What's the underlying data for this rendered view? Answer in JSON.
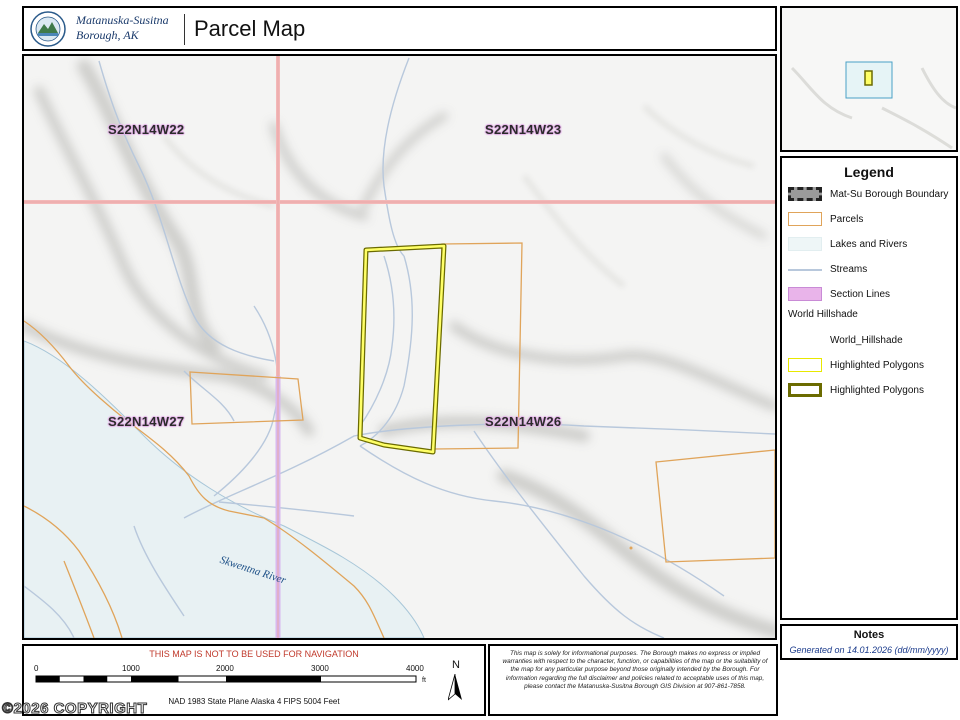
{
  "header": {
    "org_line1": "Matanuska-Susitna",
    "org_line2": "Borough, AK",
    "title": "Parcel Map"
  },
  "map": {
    "section_labels": [
      "S22N14W22",
      "S22N14W23",
      "S22N14W27",
      "S22N14W26"
    ],
    "river_label": "Skwentna River"
  },
  "legend": {
    "title": "Legend",
    "items": [
      {
        "label": "Mat-Su Borough Boundary"
      },
      {
        "label": "Parcels"
      },
      {
        "label": "Lakes and Rivers"
      },
      {
        "label": "Streams"
      },
      {
        "label": "Section Lines"
      },
      {
        "label": "World Hillshade"
      },
      {
        "label": "World_Hillshade"
      },
      {
        "label": "Highlighted Polygons"
      },
      {
        "label": "Highlighted Polygons"
      }
    ],
    "colors": {
      "parcels": "#e0a45a",
      "section_lines": "#e9b4ea",
      "highlight_fill": "#ffff66",
      "highlight_dark": "#6b6b00",
      "streams": "#b8c8dc",
      "lakes": "#eef6f7"
    }
  },
  "notes": {
    "title": "Notes",
    "text": "Generated on  14.01.2026  (dd/mm/yyyy)"
  },
  "scale": {
    "warning": "THIS MAP IS NOT TO BE USED FOR NAVIGATION",
    "ticks": [
      "0",
      "1000",
      "2000",
      "3000",
      "4000"
    ],
    "unit": "ft",
    "projection": "NAD 1983 State Plane Alaska 4 FIPS 5004 Feet",
    "north": "N",
    "copyright": "©2026 COPYRIGHT"
  },
  "disclaimer": {
    "text": "This map is solely for informational purposes. The Borough makes no express or implied warranties with respect to the character, function, or capabilities of the map or the suitability of the map for any particular purpose beyond those originally intended by the Borough. For information regarding the full disclaimer and policies related to acceptable uses of this map, please contact the Matanuska-Susitna Borough GIS Division at 907-861-7858."
  }
}
